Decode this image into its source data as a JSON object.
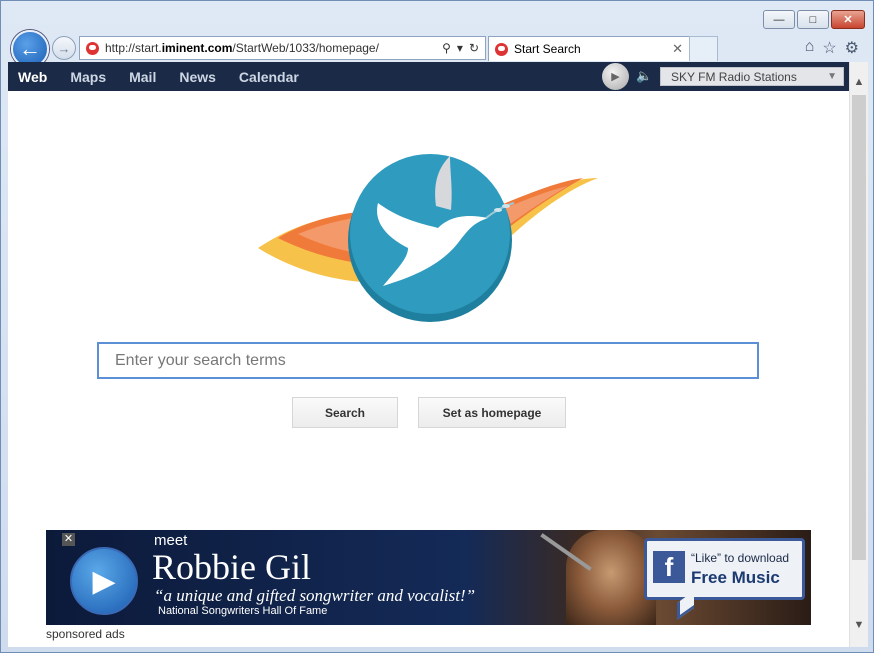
{
  "window": {
    "minimize_label": "—",
    "maximize_label": "□",
    "close_label": "✕"
  },
  "address_bar": {
    "url_prefix": "http://start.",
    "url_domain": "iminent.com",
    "url_path": "/StartWeb/1033/homepage/"
  },
  "tab": {
    "title": "Start Search"
  },
  "nav": {
    "items": [
      "Web",
      "Maps",
      "Mail",
      "News",
      "Calendar"
    ],
    "radio_station": "SKY FM Radio Stations"
  },
  "search": {
    "placeholder": "Enter your search terms",
    "search_button": "Search",
    "homepage_button": "Set as homepage"
  },
  "ad": {
    "meet": "meet",
    "name": "Robbie Gil",
    "quote": "“a unique and gifted songwriter and vocalist!”",
    "sub": "National Songwriters Hall Of Fame",
    "like_text": "“Like” to download",
    "like_cta": "Free Music",
    "fb_letter": "f"
  },
  "sponsored_label": "sponsored ads",
  "colors": {
    "nav_bg": "#1b2a46",
    "search_border": "#5b8fd6",
    "logo_teal": "#2f9cbf",
    "logo_flame_orange": "#f07a3a",
    "logo_flame_yellow": "#f7c24a"
  }
}
